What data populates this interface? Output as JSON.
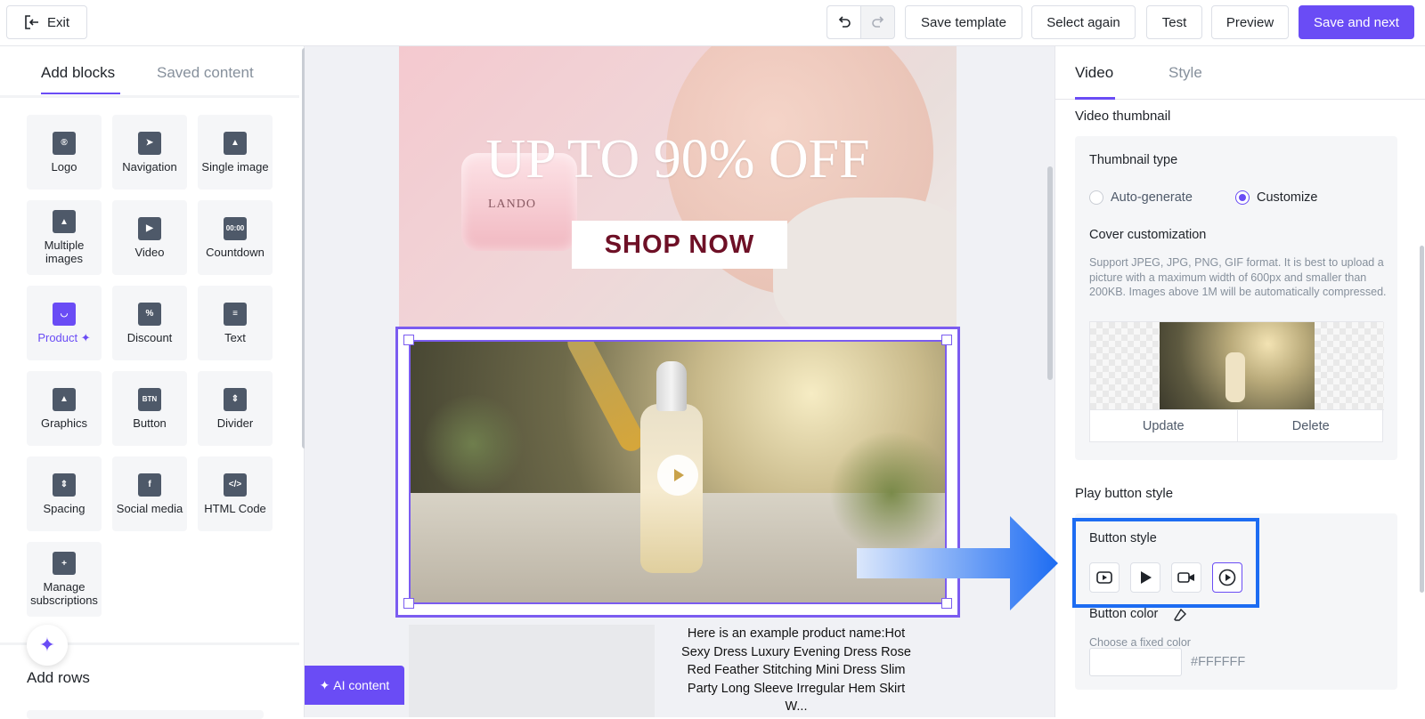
{
  "topbar": {
    "exit_label": "Exit",
    "buttons": [
      "Save template",
      "Select again",
      "Test",
      "Preview"
    ],
    "primary_label": "Save and next"
  },
  "left": {
    "tabs": [
      "Add blocks",
      "Saved content"
    ],
    "blocks": [
      {
        "label": "Logo",
        "icon": "logo-icon"
      },
      {
        "label": "Navigation",
        "icon": "navigation-icon"
      },
      {
        "label": "Single image",
        "icon": "image-icon"
      },
      {
        "label": "Multiple images",
        "icon": "images-icon"
      },
      {
        "label": "Video",
        "icon": "video-icon"
      },
      {
        "label": "Countdown",
        "icon": "countdown-icon"
      },
      {
        "label": "Product",
        "icon": "product-bag-icon"
      },
      {
        "label": "Discount",
        "icon": "discount-tag-icon"
      },
      {
        "label": "Text",
        "icon": "text-icon"
      },
      {
        "label": "Graphics",
        "icon": "graphics-icon"
      },
      {
        "label": "Button",
        "icon": "button-icon"
      },
      {
        "label": "Divider",
        "icon": "divider-icon"
      },
      {
        "label": "Spacing",
        "icon": "spacing-icon"
      },
      {
        "label": "Social media",
        "icon": "facebook-icon"
      },
      {
        "label": "HTML Code",
        "icon": "code-icon"
      },
      {
        "label": "Manage subscriptions",
        "icon": "bookmark-plus-icon"
      }
    ],
    "countdown_glyph": "00:00",
    "button_glyph": "BTN",
    "add_rows": "Add rows"
  },
  "canvas": {
    "hero_title": "UP TO 90% OFF",
    "jar_label": "LANDO",
    "shop_now": "SHOP NOW",
    "product_text": "Here is an example product name:Hot Sexy Dress Luxury Evening Dress Rose Red Feather Stitching Mini Dress Slim Party Long Sleeve Irregular Hem Skirt W...",
    "ai_content": "AI content"
  },
  "right": {
    "tabs": [
      "Video",
      "Style"
    ],
    "video_thumbnail": "Video thumbnail",
    "thumbnail_type": "Thumbnail type",
    "radio_auto": "Auto-generate",
    "radio_custom": "Customize",
    "cover_customization": "Cover customization",
    "cover_hint": "Support JPEG, JPG, PNG, GIF format. It is best to upload a picture with a maximum width of 600px and smaller than 200KB. Images above 1M will be automatically compressed.",
    "update": "Update",
    "delete": "Delete",
    "play_button_style": "Play button style",
    "button_style": "Button style",
    "button_color": "Button color",
    "choose_color": "Choose a fixed color",
    "color_value": "#FFFFFF"
  },
  "colors": {
    "accent": "#6a4cf5",
    "highlight": "#1d6cf2"
  }
}
